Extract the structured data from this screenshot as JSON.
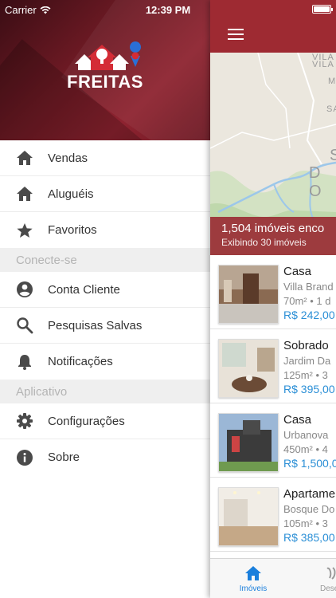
{
  "status_bar": {
    "carrier": "Carrier",
    "time": "12:39 PM",
    "battery_level": 1.0
  },
  "drawer": {
    "logo_text": "FREITAS",
    "menu": [
      {
        "label": "Vendas",
        "icon": "home-icon"
      },
      {
        "label": "Aluguéis",
        "icon": "home-icon"
      },
      {
        "label": "Favoritos",
        "icon": "star-icon"
      }
    ],
    "sections": [
      {
        "title": "Conecte-se",
        "items": [
          {
            "label": "Conta Cliente",
            "icon": "account-circle-icon"
          },
          {
            "label": "Pesquisas Salvas",
            "icon": "search-icon"
          },
          {
            "label": "Notificações",
            "icon": "bell-icon"
          }
        ]
      },
      {
        "title": "Aplicativo",
        "items": [
          {
            "label": "Configurações",
            "icon": "gear-icon"
          },
          {
            "label": "Sobre",
            "icon": "info-icon"
          }
        ]
      }
    ]
  },
  "main": {
    "map_labels": [
      "VILA",
      "VILA",
      "M",
      "SA",
      "D O",
      "S"
    ],
    "results_count": "1,504 imóveis enco",
    "results_showing": "Exibindo 30 imóveis",
    "listings": [
      {
        "title": "Casa",
        "place": "Villa Brand",
        "area": "70m² • 1 d",
        "price": "R$ 242,00"
      },
      {
        "title": "Sobrado",
        "place": "Jardim Da",
        "area": "125m² • 3",
        "price": "R$ 395,00"
      },
      {
        "title": "Casa",
        "place": "Urbanova",
        "area": "450m² • 4",
        "price": "R$ 1,500,0"
      },
      {
        "title": "Apartame",
        "place": "Bosque Do",
        "area": "105m² • 3",
        "price": "R$ 385,00"
      }
    ],
    "tabs": [
      {
        "label": "Imóveis",
        "icon": "home-icon",
        "active": true
      },
      {
        "label": "Dese",
        "icon": "wish-icon",
        "active": false
      }
    ]
  },
  "colors": {
    "brand": "#9e2a32",
    "price": "#2b8fd6",
    "tab_active": "#1a7fdc"
  }
}
